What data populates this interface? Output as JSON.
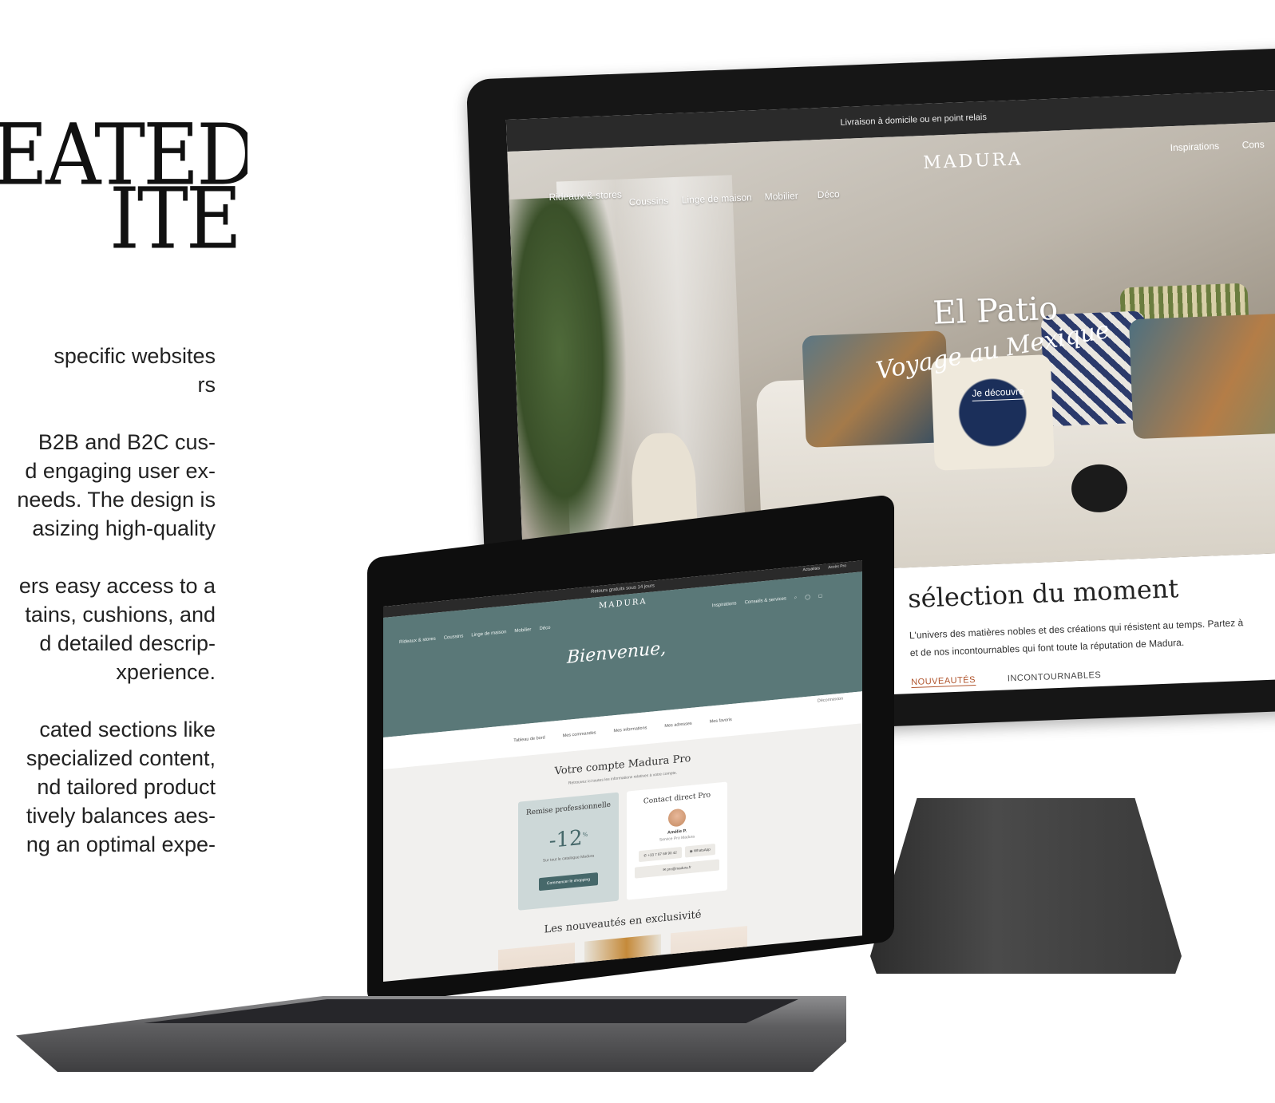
{
  "left": {
    "title_lines": [
      "EATED",
      "ITE"
    ],
    "subhead_lines": [
      "specific websites",
      "rs"
    ],
    "paragraph1": [
      "B2B and B2C cus-",
      "d engaging user ex-",
      "needs. The design is",
      "asizing high-quality"
    ],
    "paragraph2": [
      "ers easy access to a",
      "tains, cushions, and",
      "d detailed descrip-",
      "xperience."
    ],
    "paragraph3": [
      "cated sections like",
      "specialized content,",
      "nd tailored product",
      "tively balances aes-",
      "ng an optimal expe-"
    ]
  },
  "monitor": {
    "topbar": "Livraison à domicile ou en point relais",
    "logo": "MADURA",
    "nav": [
      "Rideaux & stores",
      "Coussins",
      "Linge de maison",
      "Mobilier",
      "Déco"
    ],
    "nav_right": [
      "Inspirations",
      "Cons"
    ],
    "hero_title": "El Patio",
    "hero_script": "Voyage au Mexique",
    "hero_cta": "Je découvre",
    "section_title": "sélection du moment",
    "section_text": [
      "L'univers des matières nobles et des créations qui résistent au temps. Partez à",
      "et de nos incontournables qui font toute la réputation de Madura."
    ],
    "tabs": [
      "NOUVEAUTÉS",
      "INCONTOURNABLES"
    ]
  },
  "laptop": {
    "topbar": "Retours gratuits sous 14 jours",
    "logo": "MADURA",
    "nav": [
      "Rideaux & stores",
      "Coussins",
      "Linge de maison",
      "Mobilier",
      "Déco"
    ],
    "nav_right": [
      "Inspirations",
      "Conseils & services"
    ],
    "top_links": [
      "Actualités",
      "Accès Pro"
    ],
    "welcome": "Bienvenue,",
    "tabs": [
      "Tableau de bord",
      "Mes commandes",
      "Mes informations",
      "Mes adresses",
      "Mes favoris"
    ],
    "logout": "Déconnexion",
    "account_title": "Votre compte Madura Pro",
    "account_sub": "Retrouvez ici toutes les informations relatives à votre compte.",
    "discount_card": {
      "title": "Remise professionnelle",
      "value": "-12",
      "unit": "%",
      "sub": "Sur tout le catalogue Madura",
      "button": "Commencer le shopping"
    },
    "contact_card": {
      "title": "Contact direct Pro",
      "name": "Amélie P.",
      "role": "Service Pro Madura",
      "phone": "+33 7 87 69 90 42",
      "whatsapp": "WhatsApp",
      "email": "pro@madura.fr"
    },
    "new_title": "Les nouveautés en exclusivité"
  }
}
